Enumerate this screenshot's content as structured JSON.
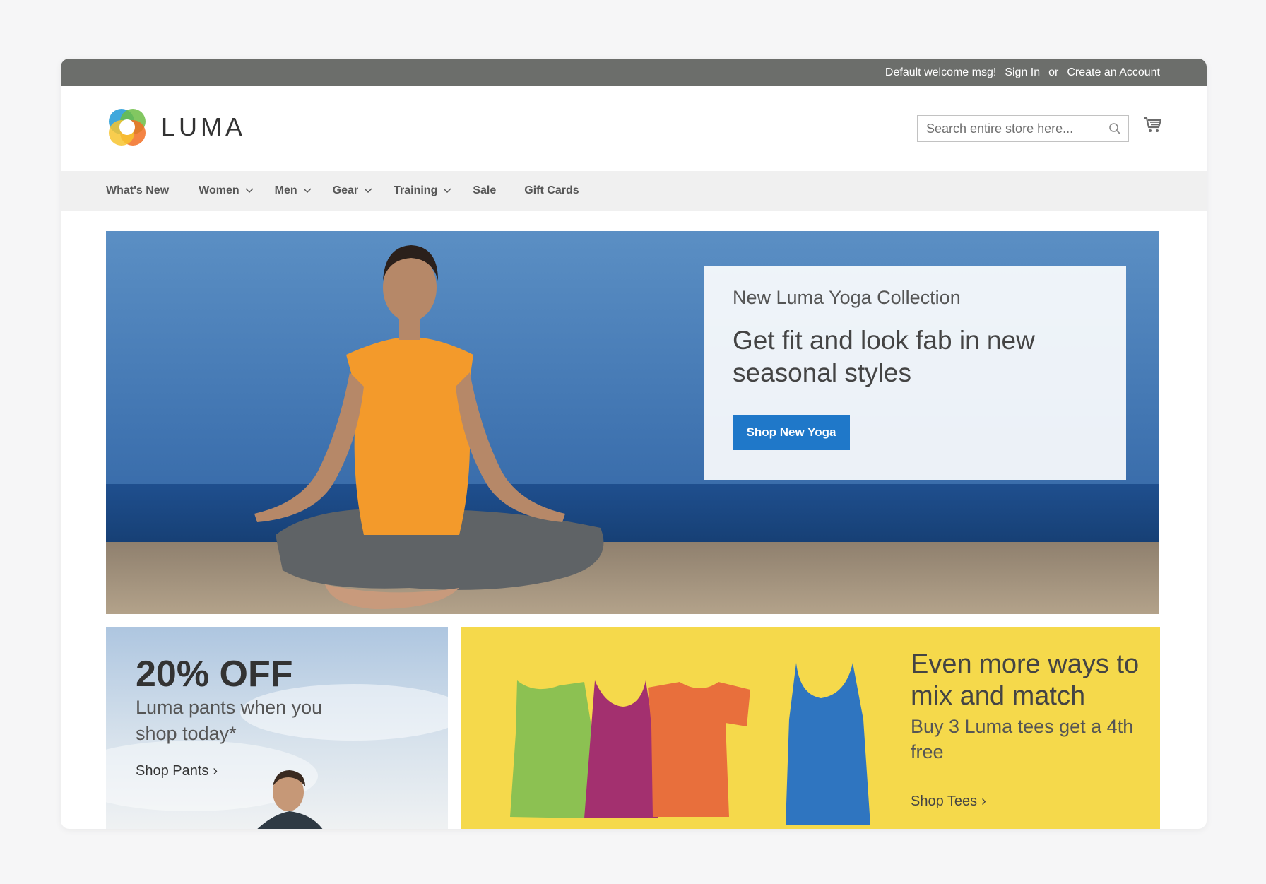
{
  "topbar": {
    "welcome": "Default welcome msg!",
    "sign_in": "Sign In",
    "or": "or",
    "create_account": "Create an Account"
  },
  "header": {
    "logo_text": "LUMA",
    "search_placeholder": "Search entire store here...",
    "icons": {
      "search": "search-icon",
      "cart": "cart-icon"
    }
  },
  "nav": {
    "items": [
      {
        "label": "What's New",
        "dropdown": false
      },
      {
        "label": "Women",
        "dropdown": true
      },
      {
        "label": "Men",
        "dropdown": true
      },
      {
        "label": "Gear",
        "dropdown": true
      },
      {
        "label": "Training",
        "dropdown": true
      },
      {
        "label": "Sale",
        "dropdown": false
      },
      {
        "label": "Gift Cards",
        "dropdown": false
      }
    ]
  },
  "hero": {
    "kicker": "New Luma Yoga Collection",
    "title": "Get fit and look fab in new seasonal styles",
    "button": "Shop New Yoga",
    "button_color": "#1f78c9"
  },
  "pants_banner": {
    "title": "20% OFF",
    "subtitle": "Luma pants when you shop today*",
    "link": "Shop Pants"
  },
  "tees_banner": {
    "title": "Even more ways to mix and match",
    "subtitle": "Buy 3 Luma tees get a 4th free",
    "link": "Shop Tees",
    "background": "#f5d94b"
  },
  "colors": {
    "topbar": "#6c6e6b",
    "nav_bg": "#f0f0f0",
    "accent": "#1f78c9"
  }
}
